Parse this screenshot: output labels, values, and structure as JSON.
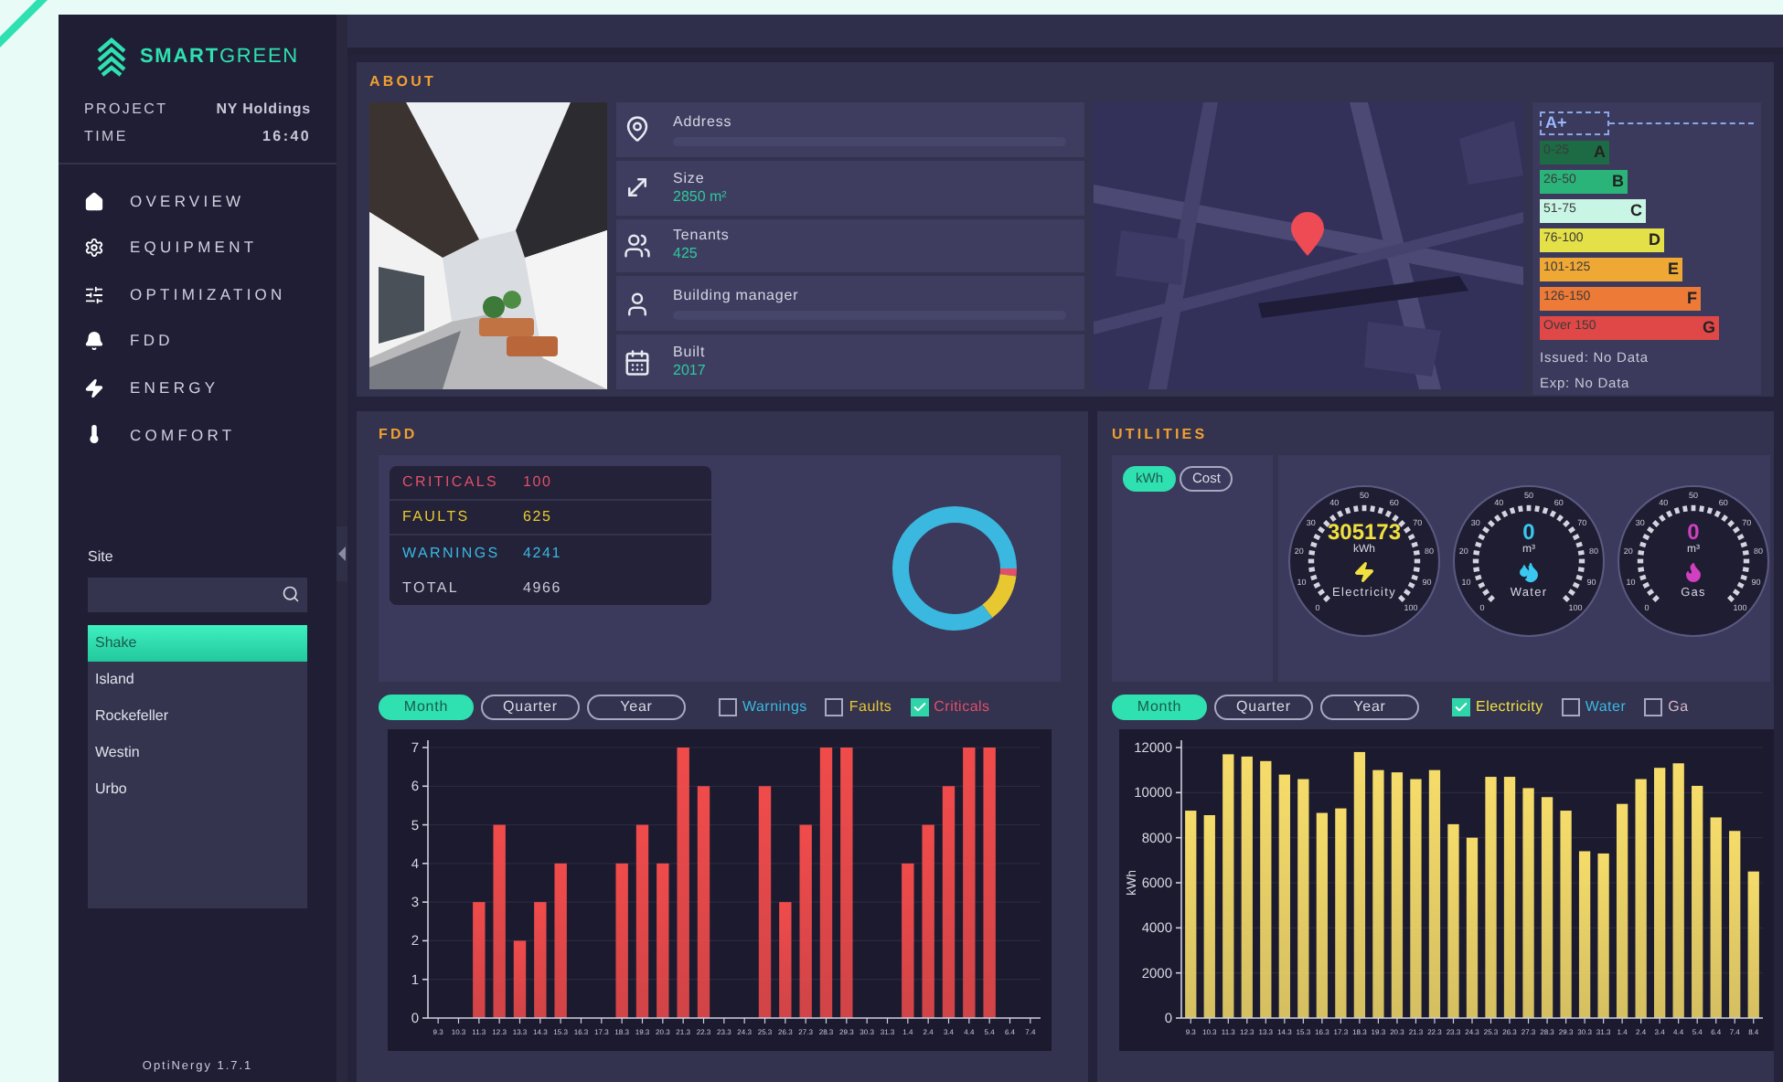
{
  "sidebar": {
    "logo": "**SMART**GREEN",
    "project_label": "PROJECT",
    "project": "NY Holdings",
    "time_label": "TIME",
    "time": "16:40",
    "nav": [
      {
        "label": "OVERVIEW"
      },
      {
        "label": "EQUIPMENT"
      },
      {
        "label": "OPTIMIZATION"
      },
      {
        "label": "FDD"
      },
      {
        "label": "ENERGY"
      },
      {
        "label": "COMFORT"
      }
    ],
    "site_label": "Site",
    "sites": [
      {
        "label": "Shake",
        "selected": true
      },
      {
        "label": "Island",
        "selected": false
      },
      {
        "label": "Rockefeller",
        "selected": false
      },
      {
        "label": "Westin",
        "selected": false
      },
      {
        "label": "Urbo",
        "selected": false
      }
    ],
    "version": "OptiNergy 1.7.1"
  },
  "about": {
    "title": "ABOUT",
    "info": [
      {
        "label": "Address"
      },
      {
        "label": "Size",
        "value": "2850 m²"
      },
      {
        "label": "Tenants",
        "value": "425"
      },
      {
        "label": "Building manager"
      },
      {
        "label": "Built",
        "value": "2017"
      }
    ],
    "rating": {
      "current": "A+",
      "bands": [
        {
          "range": "0-25",
          "grade": "A",
          "color": "#1d6b45"
        },
        {
          "range": "26-50",
          "grade": "B",
          "color": "#2bb47a"
        },
        {
          "range": "51-75",
          "grade": "C",
          "color": "#c8f5e4"
        },
        {
          "range": "76-100",
          "grade": "D",
          "color": "#e4e048"
        },
        {
          "range": "101-125",
          "grade": "E",
          "color": "#f0a835"
        },
        {
          "range": "126-150",
          "grade": "F",
          "color": "#ee7a38"
        },
        {
          "range": "Over 150",
          "grade": "G",
          "color": "#e04848"
        }
      ],
      "issued": "Issued: No Data",
      "expires": "Exp: No Data"
    }
  },
  "fdd": {
    "title": "FDD",
    "stats": [
      {
        "label": "CRITICALS",
        "value": "100",
        "color": "#e0506a"
      },
      {
        "label": "FAULTS",
        "value": "625",
        "color": "#e8c830"
      },
      {
        "label": "WARNINGS",
        "value": "4241",
        "color": "#3ab8e0"
      },
      {
        "label": "TOTAL",
        "value": "4966",
        "color": "#c8c8d4"
      }
    ],
    "donut": {
      "chart_data": {
        "type": "donut",
        "values": [
          2.0,
          12.6,
          85.4
        ]
      }
    },
    "history": {
      "periods": [
        {
          "label": "Month",
          "selected": true
        },
        {
          "label": "Quarter",
          "selected": false
        },
        {
          "label": "Year",
          "selected": false
        }
      ],
      "filters": [
        {
          "label": "Warnings",
          "checked": false,
          "color": "#3ab8e0"
        },
        {
          "label": "Faults",
          "checked": false,
          "color": "#e8c830"
        },
        {
          "label": "Criticals",
          "checked": true,
          "color": "#e0506a"
        }
      ],
      "chart_data": {
        "type": "bar",
        "categories": [
          "9.3",
          "10.3",
          "11.3",
          "12.3",
          "13.3",
          "14.3",
          "15.3",
          "16.3",
          "17.3",
          "18.3",
          "19.3",
          "20.3",
          "21.3",
          "22.3",
          "23.3",
          "24.3",
          "25.3",
          "26.3",
          "27.3",
          "28.3",
          "29.3",
          "30.3",
          "31.3",
          "1.4",
          "2.4",
          "3.4",
          "4.4",
          "5.4",
          "6.4",
          "7.4"
        ],
        "grid": true,
        "series": [
          {
            "color": "#f04b4b",
            "values": [
              0,
              0,
              3,
              5,
              2,
              3,
              4,
              0,
              0,
              4,
              5,
              4,
              7,
              6,
              0,
              0,
              6,
              3,
              5,
              7,
              7,
              0,
              0,
              4,
              5,
              6,
              7,
              7,
              0,
              0
            ]
          }
        ],
        "ylim": [
          0,
          7
        ],
        "yticks": [
          0,
          1,
          2,
          3,
          4,
          5,
          6,
          7
        ]
      }
    }
  },
  "utilities": {
    "title": "UTILITIES",
    "units": [
      {
        "label": "kWh",
        "selected": true
      },
      {
        "label": "Cost",
        "selected": false
      }
    ],
    "gauges": [
      {
        "value": "305173",
        "unit": "kWh",
        "label": "Electricity",
        "color": "#f0e040",
        "scale": [
          "0",
          "10",
          "20",
          "30",
          "40",
          "50",
          "60",
          "70",
          "80",
          "90",
          "100"
        ]
      },
      {
        "value": "0",
        "unit": "m³",
        "label": "Water",
        "color": "#3ac8f0",
        "scale": [
          "0",
          "10",
          "20",
          "30",
          "40",
          "50",
          "60",
          "70",
          "80",
          "90",
          "100"
        ]
      },
      {
        "value": "0",
        "unit": "m³",
        "label": "Gas",
        "color": "#d040c0",
        "scale": [
          "0",
          "10",
          "20",
          "30",
          "40",
          "50",
          "60",
          "70",
          "80",
          "90",
          "100"
        ]
      }
    ],
    "history": {
      "periods": [
        {
          "label": "Month",
          "selected": true
        },
        {
          "label": "Quarter",
          "selected": false
        },
        {
          "label": "Year",
          "selected": false
        }
      ],
      "filters": [
        {
          "label": "Electricity",
          "checked": true,
          "color": "#f0e040"
        },
        {
          "label": "Water",
          "checked": false,
          "color": "#3ab8e0"
        },
        {
          "label": "Ga",
          "checked": false,
          "color": "#d8b8c8"
        }
      ],
      "chart_data": {
        "type": "bar",
        "ylabel": "kWh",
        "categories": [
          "9.3",
          "10.3",
          "11.3",
          "12.3",
          "13.3",
          "14.3",
          "15.3",
          "16.3",
          "17.3",
          "18.3",
          "19.3",
          "20.3",
          "21.3",
          "22.3",
          "23.3",
          "24.3",
          "25.3",
          "26.3",
          "27.3",
          "28.3",
          "29.3",
          "30.3",
          "31.3",
          "1.4",
          "2.4",
          "3.4",
          "4.4",
          "5.4",
          "6.4",
          "7.4",
          "8.4"
        ],
        "grid": true,
        "series": [
          {
            "color": "#f5dc6a",
            "values": [
              9200,
              9000,
              11700,
              11600,
              11400,
              10800,
              10600,
              9100,
              9300,
              11800,
              11000,
              10900,
              10600,
              11000,
              8600,
              8000,
              10700,
              10700,
              10200,
              9800,
              9200,
              7400,
              7300,
              9500,
              10600,
              11100,
              11300,
              10300,
              8900,
              8300,
              6500
            ]
          }
        ],
        "ylim": [
          0,
          12000
        ],
        "yticks": [
          0,
          2000,
          4000,
          6000,
          8000,
          10000,
          12000
        ]
      }
    }
  }
}
